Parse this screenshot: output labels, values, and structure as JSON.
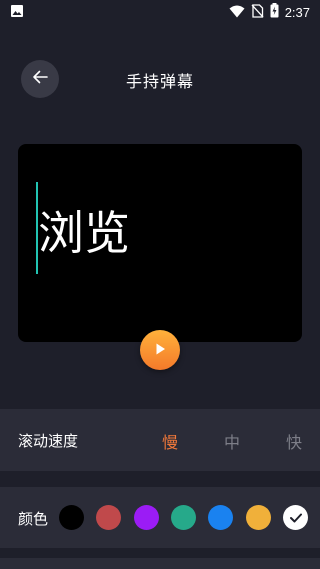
{
  "status_bar": {
    "time": "2:37",
    "icons": [
      "image-icon",
      "wifi-icon",
      "no-sim-icon",
      "battery-charging-icon"
    ]
  },
  "header": {
    "title": "手持弹幕",
    "back_icon": "arrow-left-icon"
  },
  "preview": {
    "text": "浏览",
    "text_color": "#ffffff",
    "background": "#000000",
    "cursor_color": "#22c4b3",
    "play_icon": "play-icon"
  },
  "speed": {
    "label": "滚动速度",
    "options": [
      "慢",
      "中",
      "快"
    ],
    "selected": "慢",
    "active_color": "#f0783a"
  },
  "colors": {
    "label": "颜色",
    "swatches": [
      "#000000",
      "#c0494b",
      "#9b1cf5",
      "#26a98a",
      "#1a82f0",
      "#f0b03a",
      "#ffffff"
    ],
    "selected_index": 6
  }
}
